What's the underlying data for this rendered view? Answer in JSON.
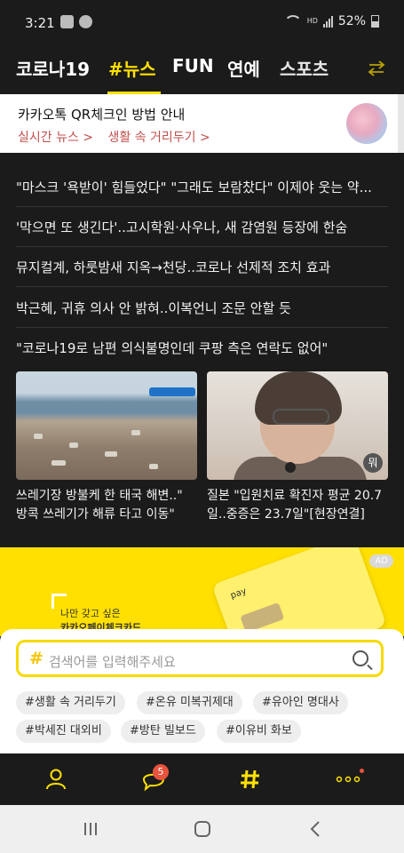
{
  "status": {
    "time": "3:21",
    "battery": "52%",
    "signal_label": "HD"
  },
  "tabs": [
    {
      "label": "코로나19",
      "active": false
    },
    {
      "label": "#뉴스",
      "active": true
    },
    {
      "label": "FUN",
      "active": false
    },
    {
      "label": "연예",
      "active": false
    },
    {
      "label": "스포츠",
      "active": false
    }
  ],
  "notice": {
    "title": "카카오톡 QR체크인 방법 안내",
    "links": [
      "실시간 뉴스 >",
      "생활 속 거리두기 >"
    ]
  },
  "headlines": [
    "\"마스크 '욕받이' 힘들었다\" \"그래도 보람찼다\" 이제야 웃는 약...",
    "'막으면 또 생긴다'..고시학원·사우나, 새 감염원 등장에 한숨",
    "뮤지컬계, 하룻밤새 지옥→천당..코로나 선제적 조치 효과",
    "박근혜, 귀휴 의사 안 밝혀..이복언니 조문 안할 듯",
    "\"코로나19로 남편 의식불명인데 쿠팡 측은 연락도 없어\""
  ],
  "cards": [
    {
      "caption": "쓰레기장 방불케 한 태국 해변..\" 방콕 쓰레기가 해류 타고 이동\""
    },
    {
      "caption": "질본 \"입원치료 확진자 평균 20.7일..중증은 23.7일\"[현장연결]",
      "logo": "뭐"
    }
  ],
  "ad": {
    "badge": "AD",
    "line1": "나만 갖고 싶은",
    "line2": "카카오페이체크카드",
    "card_brand": "pay"
  },
  "search": {
    "placeholder": "검색어를 입력해주세요",
    "hash": "#",
    "chips": [
      "#생활 속 거리두기",
      "#온유 미복귀제대",
      "#유아인 명대사",
      "#박세진 대외비",
      "#방탄 빌보드",
      "#이유비 화보"
    ]
  },
  "bottom_nav": {
    "chat_badge": "5",
    "icons": [
      "person-icon",
      "chat-icon",
      "hashtag-icon",
      "more-icon"
    ]
  },
  "colors": {
    "accent": "#ffe100",
    "link_red": "#c0504d",
    "ad_yellow": "#ffe000"
  }
}
